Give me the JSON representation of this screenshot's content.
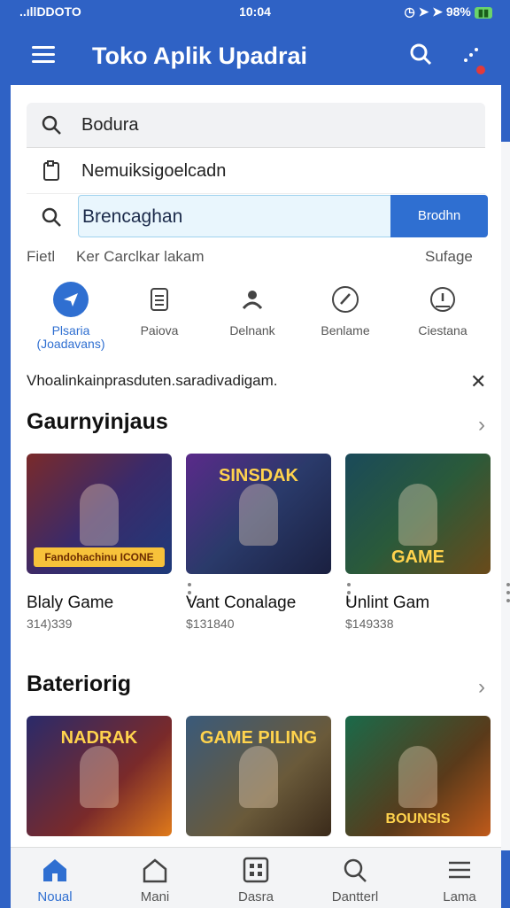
{
  "status_bar": {
    "left": "..ıllDDOTO",
    "time": "10:04",
    "right": "◷ ➤ ➤ 98%",
    "battery": "▮▮"
  },
  "header": {
    "title": "Toko Aplik Upadrai"
  },
  "search": {
    "row1_text": "Bodura",
    "row2_text": "Nemuiksigoelcadn",
    "row3_text": "Brencaghan",
    "button": "Brodhn"
  },
  "filter": {
    "left": "Fietl",
    "middle": "Ker Carclkar lakam",
    "right": "Sufage"
  },
  "categories": [
    {
      "label": "Plsaria (Joadavans)"
    },
    {
      "label": "Paiova"
    },
    {
      "label": "Delnank"
    },
    {
      "label": "Benlame"
    },
    {
      "label": "Ciestana"
    }
  ],
  "notice": "Vhoalinkainprasduten.saradivadigam.",
  "section1": {
    "title": "Gaurnyinjaus",
    "items": [
      {
        "name": "Blaly Game",
        "size": "314)339",
        "badge": "Fandohachinu ICONE"
      },
      {
        "name": "Vant Conalage",
        "size": "$131840",
        "badge": "SINSDAK"
      },
      {
        "name": "Unlint Gam",
        "size": "$149338",
        "badge": "GAME"
      }
    ]
  },
  "section2": {
    "title": "Bateriorig",
    "items": [
      {
        "badge": "NADRAK"
      },
      {
        "badge": "GAME PILING"
      },
      {
        "badge": "BOUNSIS"
      }
    ]
  },
  "bottom_nav": [
    {
      "label": "Noual"
    },
    {
      "label": "Mani"
    },
    {
      "label": "Dasra"
    },
    {
      "label": "Dantterl"
    },
    {
      "label": "Lama"
    }
  ],
  "colors": {
    "primary": "#2f62c5",
    "accent": "#2f6fd1"
  }
}
